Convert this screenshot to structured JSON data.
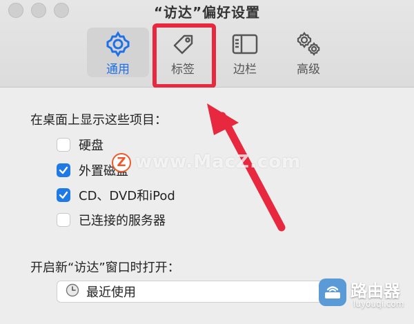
{
  "window": {
    "title": "“访达”偏好设置"
  },
  "tabs": [
    {
      "label": "通用",
      "icon": "gear-icon",
      "active": true
    },
    {
      "label": "标签",
      "icon": "tag-icon",
      "active": false
    },
    {
      "label": "边栏",
      "icon": "sidebar-icon",
      "active": false
    },
    {
      "label": "高级",
      "icon": "gears-icon",
      "active": false
    }
  ],
  "desktop_section": {
    "heading": "在桌面上显示这些项目：",
    "items": [
      {
        "label": "硬盘",
        "checked": false
      },
      {
        "label": "外置磁盘",
        "checked": true
      },
      {
        "label": "CD、DVD和iPod",
        "checked": true
      },
      {
        "label": "已连接的服务器",
        "checked": false
      }
    ]
  },
  "new_window_section": {
    "heading": "开启新“访达”窗口时打开：",
    "selected": "最近使用"
  },
  "annotation": {
    "highlight_color": "#e8283f"
  },
  "watermark": {
    "text": "www.MacZ.com",
    "logo_letter": "Z"
  },
  "brand": {
    "name": "路由器",
    "url": "luyouqi.com"
  },
  "colors": {
    "accent": "#1f6fe6",
    "checkbox_checked": "#1f7ae6"
  }
}
